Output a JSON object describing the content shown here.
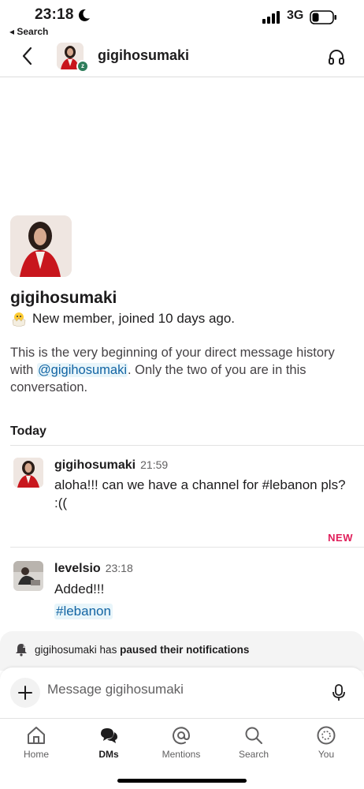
{
  "status_bar": {
    "time": "23:18",
    "back_app": "◂ Search",
    "network": "3G"
  },
  "header": {
    "title": "gigihosumaki",
    "status_letter": "z"
  },
  "profile": {
    "name": "gigihosumaki",
    "badge_text": "New member, joined 10 days ago.",
    "intro_before": "This is the very beginning of your direct message history with ",
    "intro_mention": "@gigihosumaki",
    "intro_after": ". Only the two of you are in this conversation."
  },
  "today_label": "Today",
  "messages": [
    {
      "author": "gigihosumaki",
      "time": "21:59",
      "text": "aloha!!! can we have a channel for #lebanon pls? :(("
    },
    {
      "author": "levelsio",
      "time": "23:18",
      "text": "Added!!!",
      "link": "#lebanon"
    }
  ],
  "new_label": "NEW",
  "banner": {
    "user": "gigihosumaki",
    "has": " has ",
    "paused": "paused their notifications"
  },
  "composer": {
    "placeholder": "Message gigihosumaki"
  },
  "tabs": [
    {
      "label": "Home",
      "icon": "home-icon"
    },
    {
      "label": "DMs",
      "icon": "dms-icon"
    },
    {
      "label": "Mentions",
      "icon": "mentions-icon"
    },
    {
      "label": "Search",
      "icon": "search-icon"
    },
    {
      "label": "You",
      "icon": "you-icon"
    }
  ],
  "colors": {
    "link": "#1264a3",
    "new": "#e01e5a",
    "away": "#2e7d5b"
  }
}
